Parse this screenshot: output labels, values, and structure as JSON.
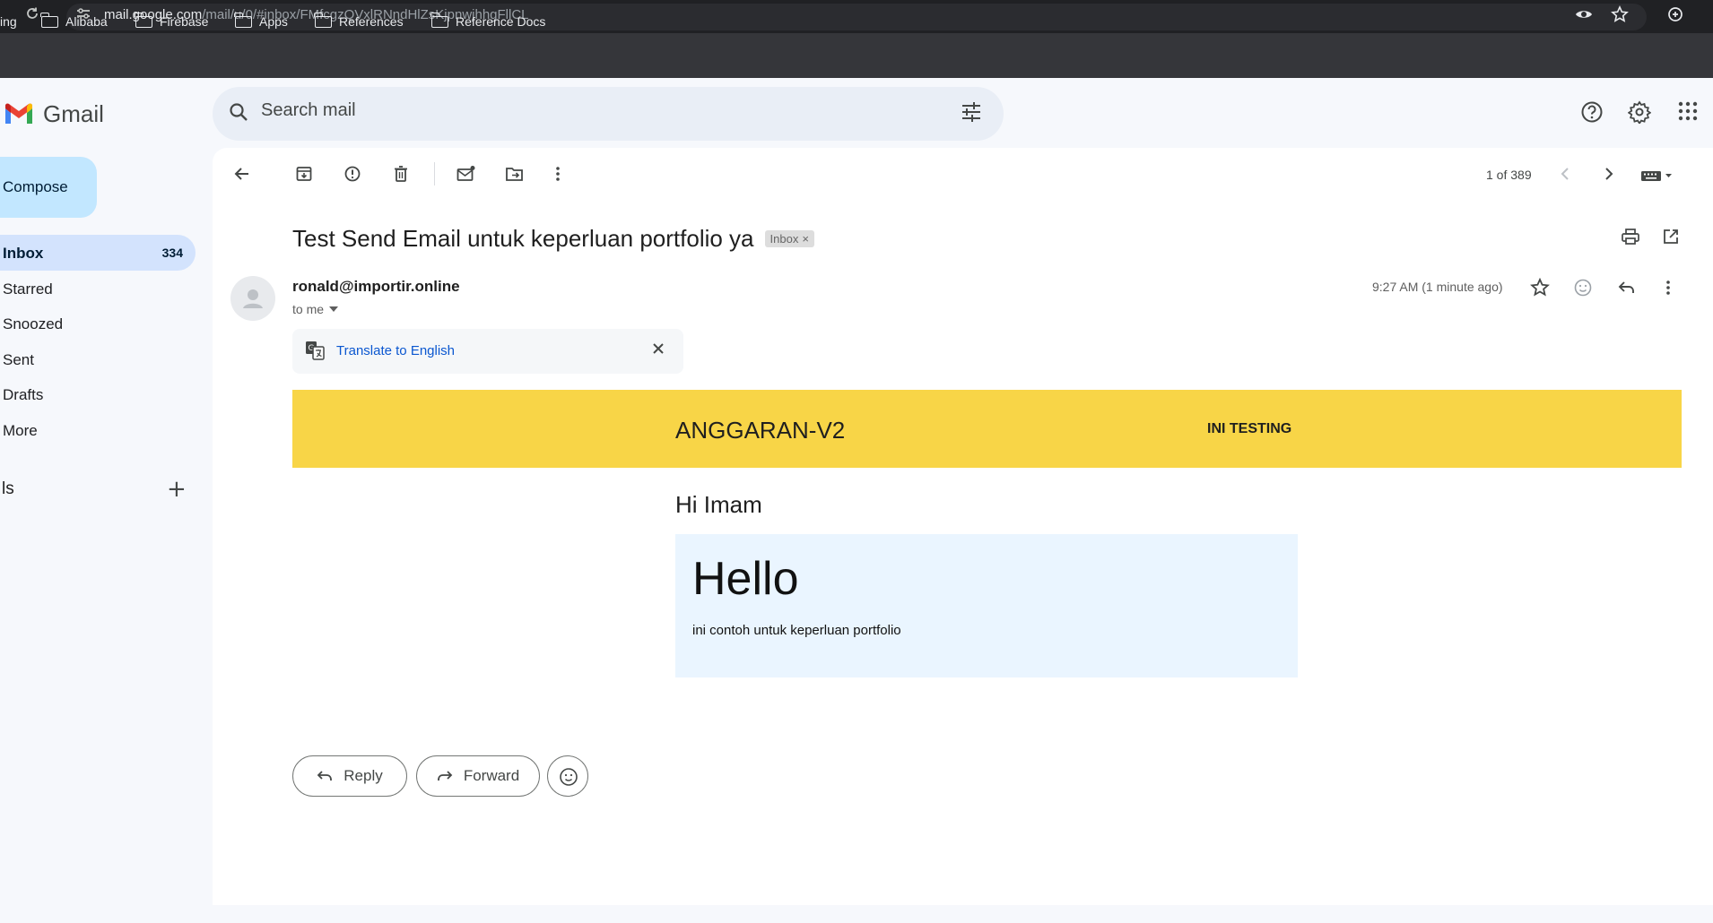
{
  "browser": {
    "url_host": "mail.google.com",
    "url_path": "/mail/u/0/#inbox/FMfcgzQVxlRNndHlZsKjpnwjhhgFllCL",
    "bookmarks": [
      {
        "label": "ing"
      },
      {
        "label": "Alibaba"
      },
      {
        "label": "Firebase"
      },
      {
        "label": "Apps"
      },
      {
        "label": "References"
      },
      {
        "label": "Reference Docs"
      }
    ]
  },
  "app": {
    "name": "Gmail",
    "brand_colors": {
      "red": "#ea4335",
      "blue": "#4285f4",
      "green": "#34a853",
      "yellow": "#fbbc04"
    }
  },
  "search": {
    "placeholder": "Search mail"
  },
  "sidebar": {
    "compose_label": "Compose",
    "items": [
      {
        "label": "Inbox",
        "count": "334"
      },
      {
        "label": "Starred"
      },
      {
        "label": "Snoozed"
      },
      {
        "label": "Sent"
      },
      {
        "label": "Drafts"
      },
      {
        "label": "More"
      }
    ],
    "labels_title": "ls",
    "labels_add": "+"
  },
  "toolbar": {
    "pager_text": "1 of 389"
  },
  "message": {
    "subject": "Test Send Email untuk keperluan portfolio ya",
    "label_chip": "Inbox",
    "label_chip_close": "×",
    "sender": "ronald@importir.online",
    "to": "to me",
    "timestamp": "9:27 AM (1 minute ago)",
    "translate_label": "Translate to English"
  },
  "email_body": {
    "banner_title": "ANGGARAN-V2",
    "banner_tag": "INI TESTING",
    "banner_color": "#f8d547",
    "greeting": "Hi Imam",
    "card_heading": "Hello",
    "card_body": "ini contoh untuk keperluan portfolio",
    "card_color": "#eaf5ff"
  },
  "actions": {
    "reply_label": "Reply",
    "forward_label": "Forward"
  }
}
